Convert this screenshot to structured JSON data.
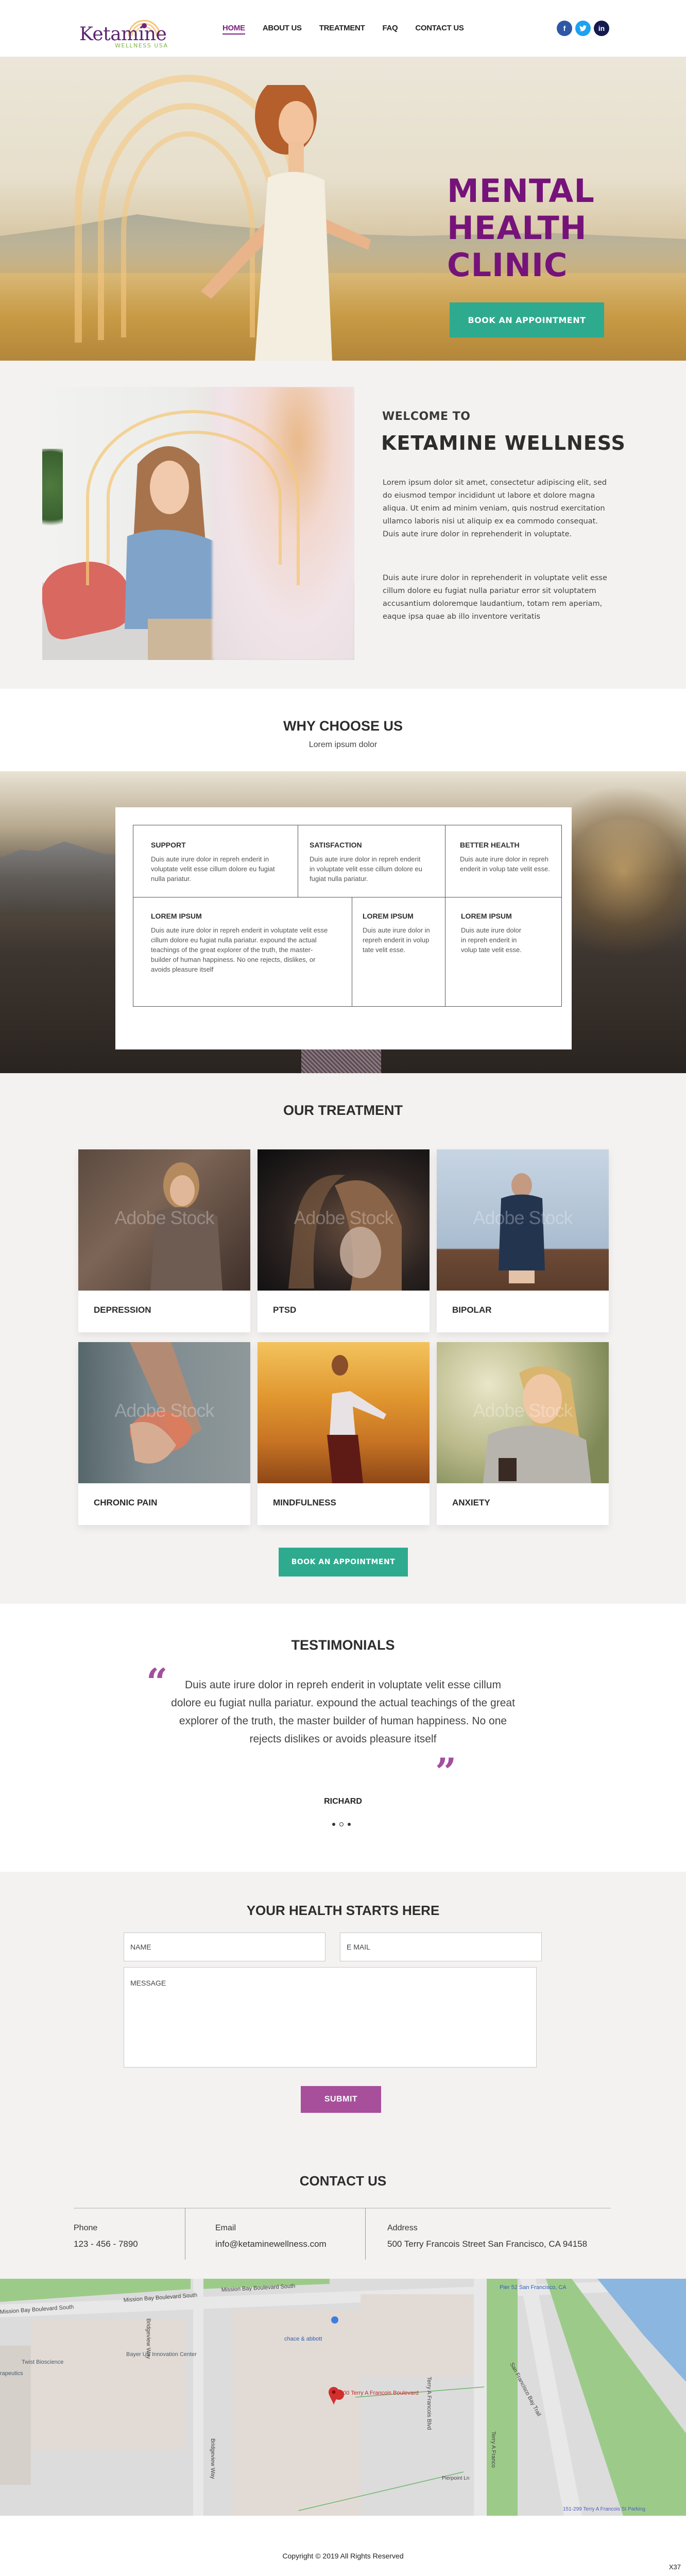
{
  "brand": {
    "logo_word": "Ketamine",
    "logo_sub": "WELLNESS USA",
    "purple": "#75137a",
    "teal": "#2eaa8f",
    "accent_pink": "#a74f9b"
  },
  "nav": {
    "items": [
      {
        "label": "HOME",
        "active": true
      },
      {
        "label": "ABOUT US"
      },
      {
        "label": "TREATMENT"
      },
      {
        "label": "FAQ"
      },
      {
        "label": "CONTACT US"
      }
    ]
  },
  "social": {
    "facebook": {
      "glyph": "f",
      "icon": "facebook-icon",
      "color": "#2f57a7"
    },
    "twitter": {
      "glyph": "t",
      "icon": "twitter-icon",
      "color": "#1da1f2"
    },
    "linkedin": {
      "glyph": "in",
      "icon": "linkedin-icon",
      "color": "#141a4e"
    }
  },
  "hero": {
    "title_line1": "MENTAL",
    "title_line2": "HEALTH",
    "title_line3": "CLINIC",
    "cta": "BOOK AN APPOINTMENT"
  },
  "about": {
    "welcome": "WELCOME TO",
    "brand": "KETAMINE WELLNESS",
    "paragraph1": "Lorem ipsum dolor sit amet, consectetur adipiscing elit, sed do eiusmod tempor incididunt ut labore et dolore magna aliqua. Ut enim ad minim veniam, quis nostrud exercitation ullamco laboris nisi ut aliquip ex ea commodo consequat. Duis aute irure dolor in reprehenderit in voluptate.",
    "paragraph2": "Duis aute irure dolor in reprehenderit in voluptate velit esse cillum dolore eu fugiat nulla pariatur  error sit voluptatem accusantium doloremque laudantium, totam rem aperiam, eaque ipsa quae ab illo inventore veritatis"
  },
  "why": {
    "title": "WHY CHOOSE US",
    "subtitle": "Lorem ipsum dolor",
    "cells": [
      {
        "title": "SUPPORT",
        "text": "Duis aute irure dolor in repreh enderit in voluptate velit esse cillum dolore eu fugiat nulla pariatur."
      },
      {
        "title": "SATISFACTION",
        "text": "Duis aute irure dolor in repreh enderit in voluptate velit esse cillum dolore eu fugiat nulla pariatur."
      },
      {
        "title": "BETTER HEALTH",
        "text": "Duis aute irure dolor in repreh enderit in volup tate velit esse."
      },
      {
        "title": "LOREM IPSUM",
        "text": "Duis aute irure dolor in repreh enderit in voluptate velit esse cillum dolore eu fugiat nulla pariatur. expound the actual teachings of the great explorer of the truth, the master-builder of human happiness. No one rejects, dislikes, or avoids pleasure itself"
      },
      {
        "title": "LOREM IPSUM",
        "text": "Duis aute irure dolor in repreh enderit in volup tate velit esse."
      },
      {
        "title": "LOREM IPSUM",
        "text": "Duis aute irure dolor in repreh enderit in volup tate velit esse."
      }
    ]
  },
  "treatment": {
    "title": "OUR TREATMENT",
    "watermark": "Adobe Stock",
    "cards": [
      {
        "label": "DEPRESSION"
      },
      {
        "label": "PTSD"
      },
      {
        "label": "BIPOLAR"
      },
      {
        "label": "CHRONIC PAIN"
      },
      {
        "label": "MINDFULNESS"
      },
      {
        "label": "ANXIETY"
      }
    ],
    "cta": "BOOK AN APPOINTMENT"
  },
  "testimonials": {
    "title": "TESTIMONIALS",
    "open_quote": "“",
    "close_quote": "”",
    "quote": "Duis aute irure dolor in repreh enderit in voluptate velit esse cillum dolore eu fugiat nulla pariatur. expound the actual teachings of the great explorer of the truth, the master builder of human happiness. No one rejects dislikes or avoids pleasure itself",
    "author": "RICHARD",
    "slides": 3,
    "active_slide": 2
  },
  "form": {
    "title": "YOUR HEALTH STARTS HERE",
    "name_placeholder": "NAME",
    "email_placeholder": "E MAIL",
    "message_placeholder": "MESSAGE",
    "name_value": "",
    "email_value": "",
    "message_value": "",
    "submit": "SUBMIT"
  },
  "contact": {
    "title": "CONTACT US",
    "phone_label": "Phone",
    "phone": "123 - 456 - 7890",
    "email_label": "Email",
    "email": "info@ketaminewellness.com",
    "address_label": "Address",
    "address": "500 Terry Francois Street San Francisco, CA 94158"
  },
  "map": {
    "streets": [
      "Mission Bay Boulevard South",
      "Mission Bay Boulevard South",
      "Mission Bay Boulevard South",
      "Bridgeview Way",
      "Terry A Francois Blvd",
      "San Francisco Bay Trail",
      "Pierpoint Ln",
      "Bridgeview Way",
      "Terry A Franco"
    ],
    "places": [
      "Twist Bioscience",
      "rapeutics",
      "Bayer US Innovation Center",
      "chace & abbott",
      "Pier 52 San Francisco, CA",
      "151-299 Terry A Francois St Parking"
    ],
    "marker_label": "500 Terry A Francois Boulevard"
  },
  "footer": {
    "copyright": "Copyright © 2019 All Rights Reserved",
    "badge": "X37"
  }
}
